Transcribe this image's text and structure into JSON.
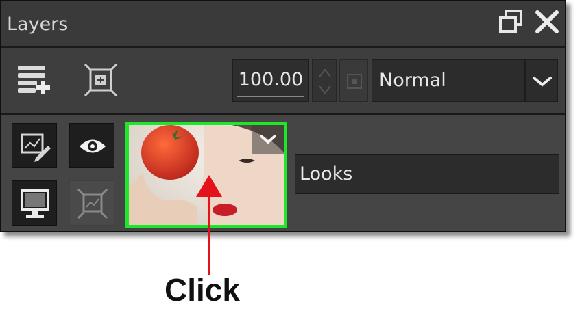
{
  "panel": {
    "title": "Layers",
    "window_buttons": {
      "restore_icon": "restore-window-icon",
      "close_icon": "close-icon"
    }
  },
  "toolbar": {
    "new_layer_icon": "add-layer-icon",
    "fit_icon": "fit-frame-icon",
    "opacity_value": "100.00",
    "blend_mode": "Normal"
  },
  "layer": {
    "name": "Looks",
    "visible": true,
    "thumbnail_selected": true
  },
  "annotation": {
    "text": "Click",
    "color": "#e4121a"
  },
  "colors": {
    "panel_bg": "#3c3c3c",
    "selection_border": "#1ee62a"
  }
}
